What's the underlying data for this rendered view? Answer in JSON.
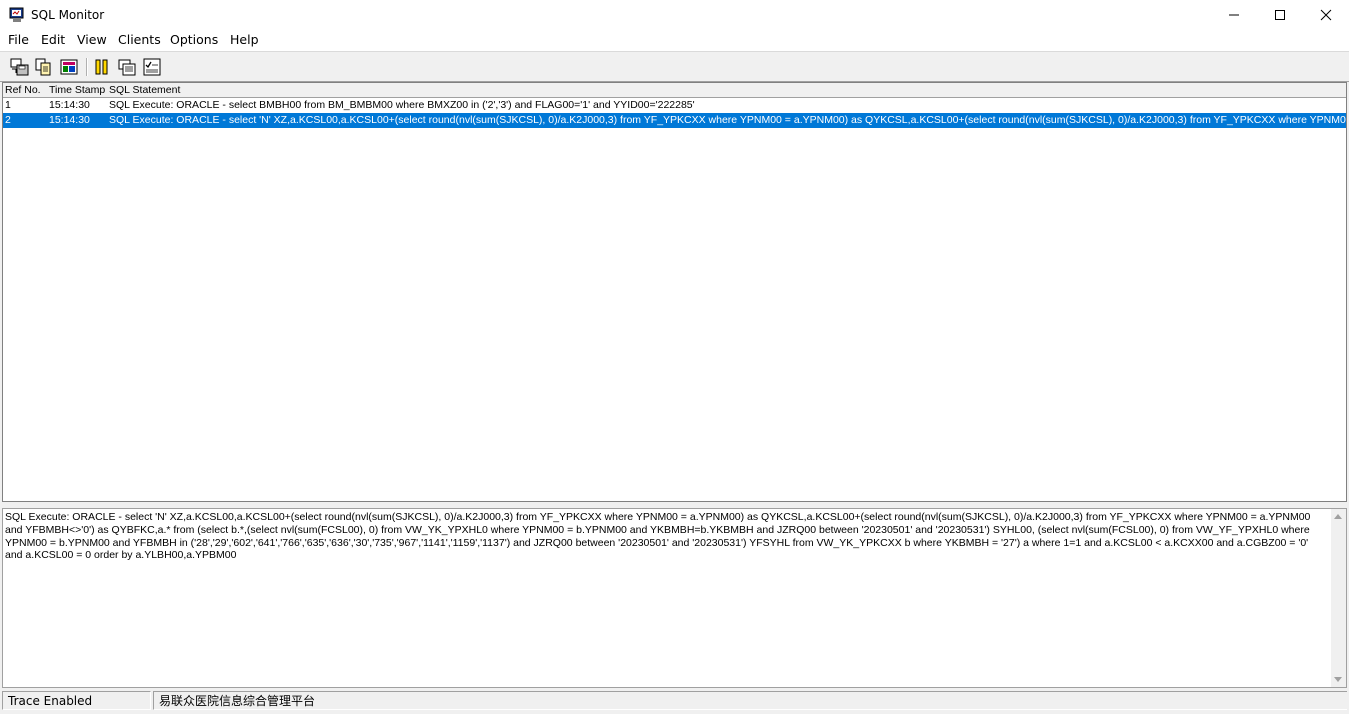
{
  "window": {
    "title": "SQL Monitor"
  },
  "menu": [
    "File",
    "Edit",
    "View",
    "Clients",
    "Options",
    "Help"
  ],
  "toolbar": {
    "buttons": [
      "save-log-icon",
      "copy-icon",
      "print-icon",
      "pause-icon",
      "clear-icon",
      "options-icon"
    ]
  },
  "grid": {
    "columns": [
      "Ref No.",
      "Time Stamp",
      "SQL Statement"
    ],
    "rows": [
      {
        "ref": "1",
        "time": "15:14:30",
        "sql": "SQL Execute: ORACLE - select BMBH00 from BM_BMBM00 where BMXZ00 in ('2','3') and FLAG00='1' and YYID00='222285'",
        "selected": false
      },
      {
        "ref": "2",
        "time": "15:14:30",
        "sql": "SQL Execute: ORACLE - select 'N' XZ,a.KCSL00,a.KCSL00+(select round(nvl(sum(SJKCSL), 0)/a.K2J000,3) from YF_YPKCXX where YPNM00 = a.YPNM00) as QYKCSL,a.KCSL00+(select round(nvl(sum(SJKCSL), 0)/a.K2J000,3) from YF_YPKCXX where YPNM00 = a.YPNM00",
        "selected": true
      }
    ]
  },
  "detail": {
    "text": "SQL Execute: ORACLE - select 'N' XZ,a.KCSL00,a.KCSL00+(select round(nvl(sum(SJKCSL), 0)/a.K2J000,3) from YF_YPKCXX where YPNM00 = a.YPNM00) as QYKCSL,a.KCSL00+(select round(nvl(sum(SJKCSL), 0)/a.K2J000,3) from YF_YPKCXX where YPNM00 = a.YPNM00 and YFBMBH<>'0') as QYBFKC,a.* from (select b.*,(select nvl(sum(FCSL00), 0) from VW_YK_YPXHL0 where YPNM00 = b.YPNM00 and YKBMBH=b.YKBMBH and JZRQ00 between '20230501' and '20230531') SYHL00, (select nvl(sum(FCSL00), 0) from VW_YF_YPXHL0 where YPNM00 = b.YPNM00 and YFBMBH in ('28','29','602','641','766','635','636','30','735','967','1141','1159','1137') and JZRQ00 between '20230501' and '20230531') YFSYHL from VW_YK_YPKCXX b where YKBMBH = '27') a where 1=1  and a.KCSL00 < a.KCXX00  and a.CGBZ00 = '0' and a.KCSL00 = 0  order by a.YLBH00,a.YPBM00"
  },
  "status": {
    "panel1": "Trace Enabled",
    "panel2": "易联众医院信息综合管理平台"
  },
  "colors": {
    "selection": "#0078d7",
    "window_bg": "#f0f0f0"
  }
}
